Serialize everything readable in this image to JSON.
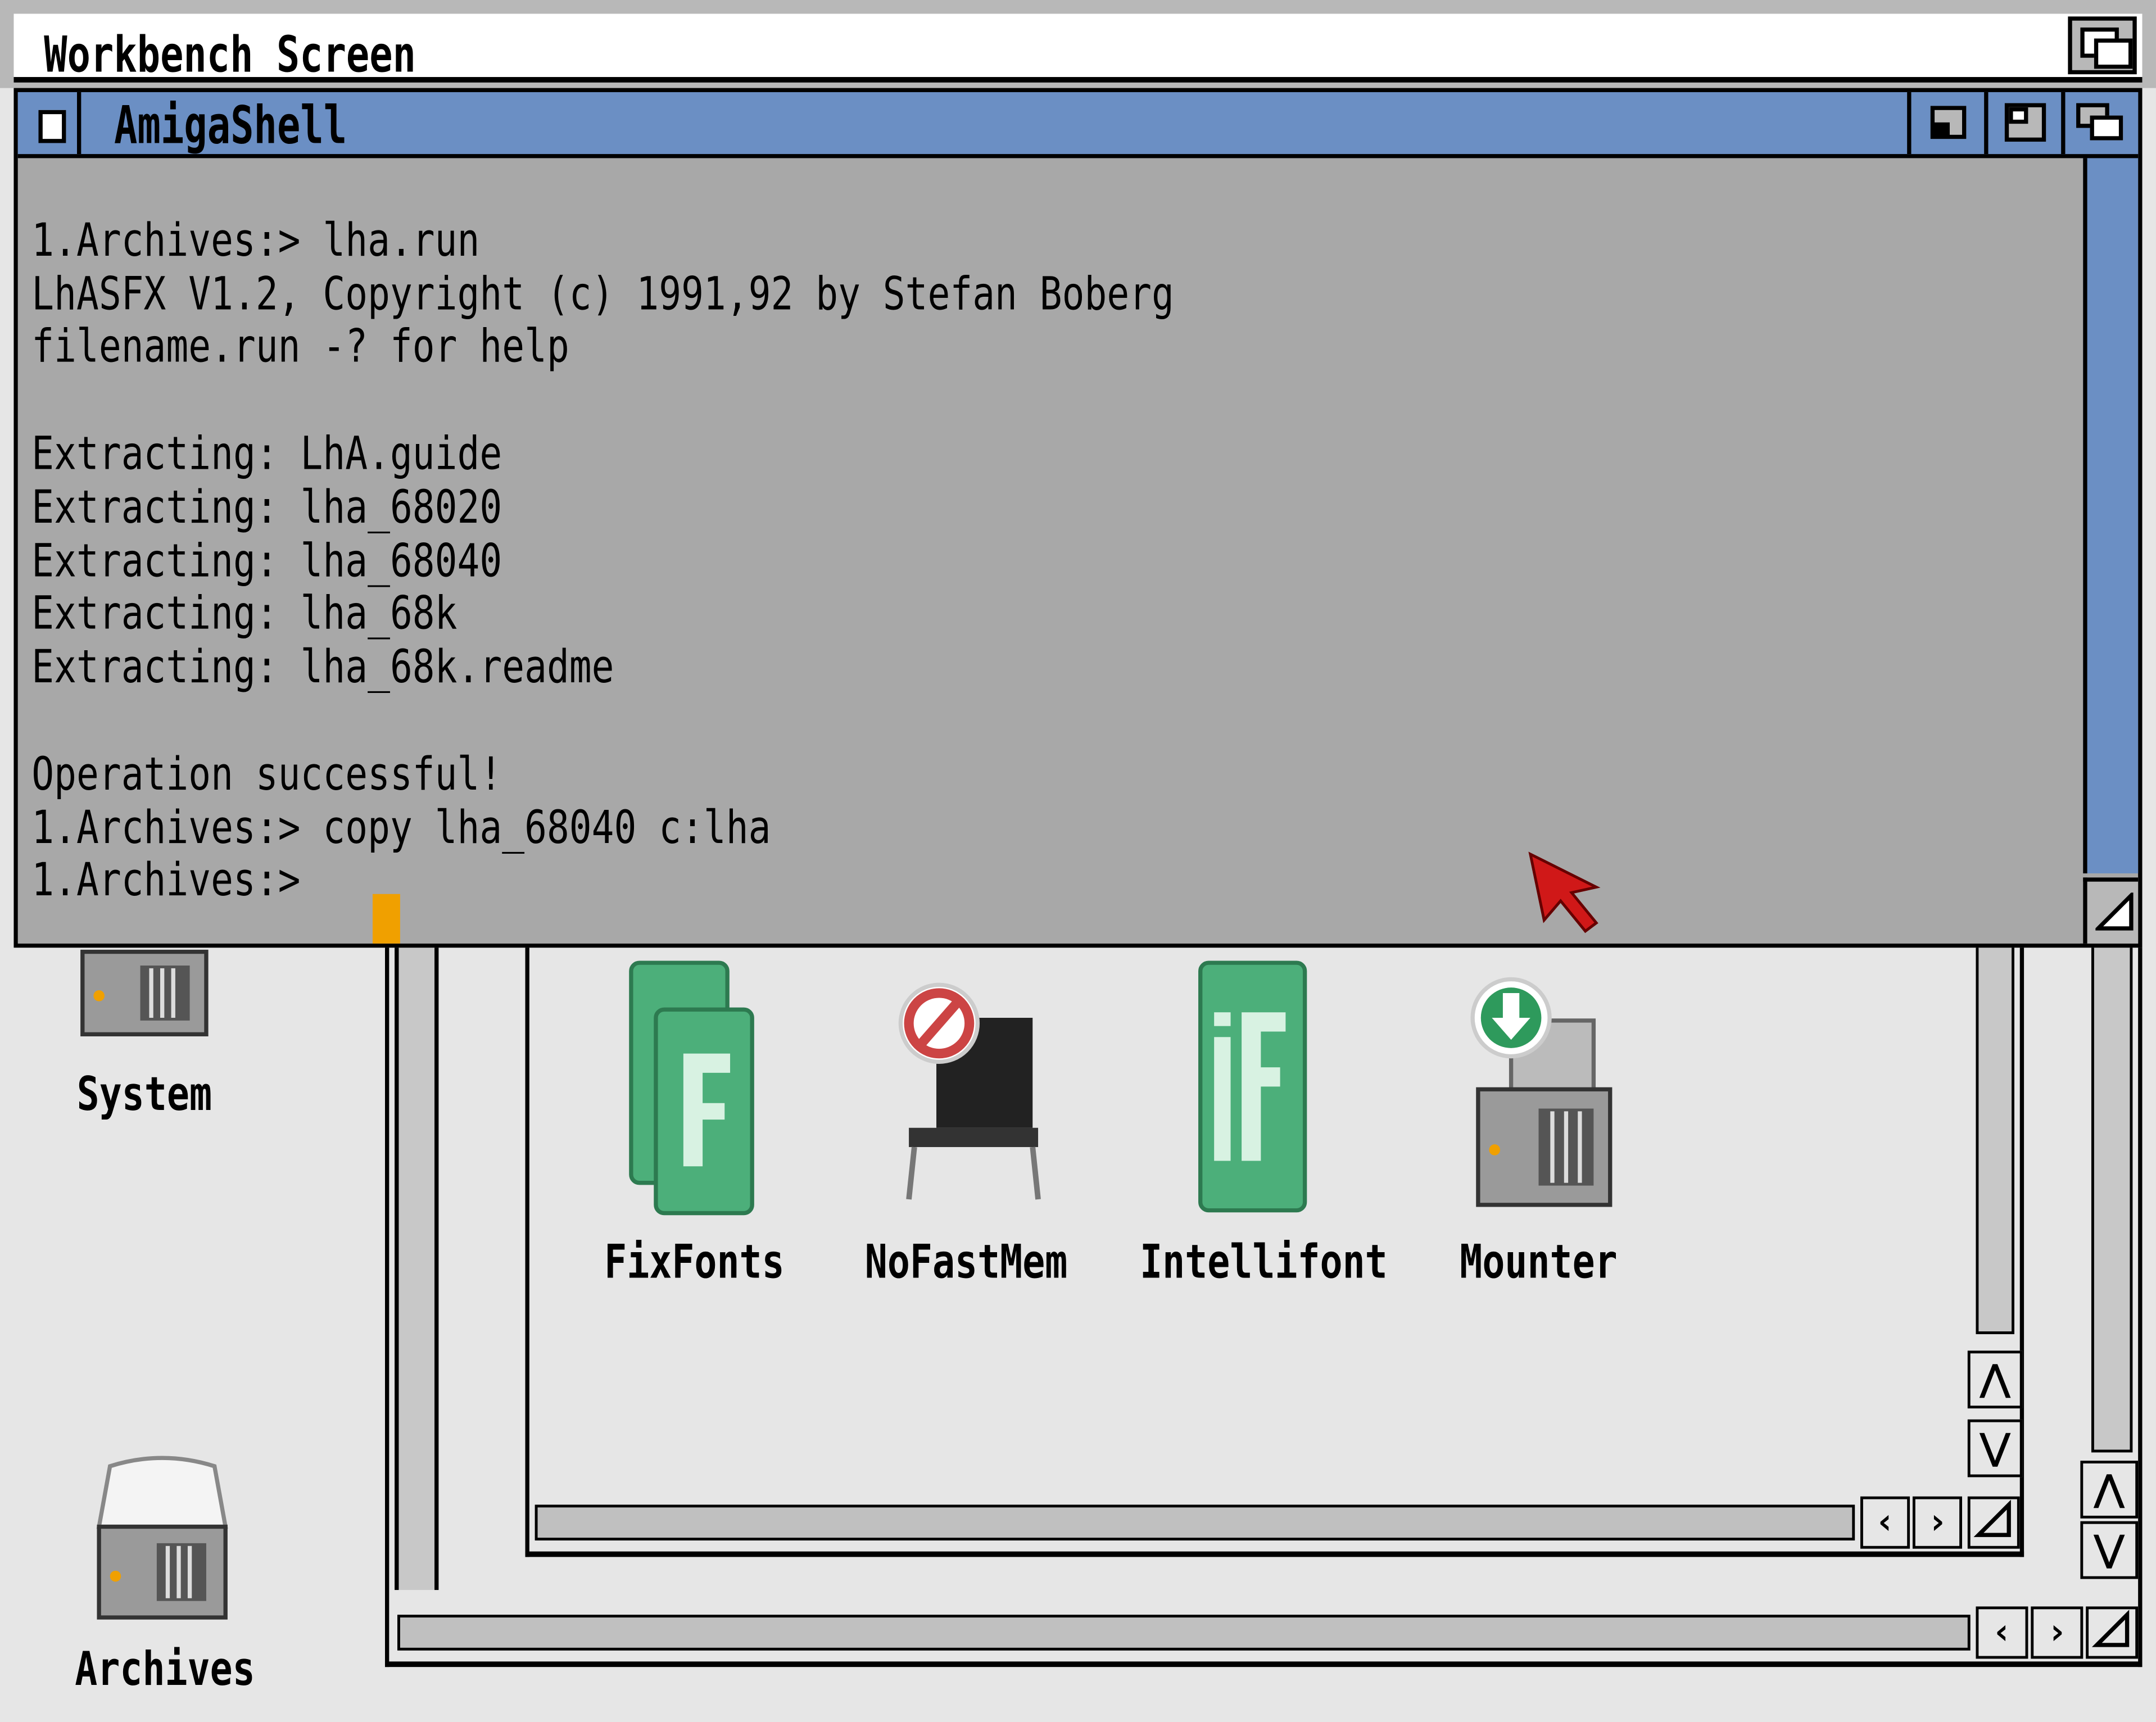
{
  "screen": {
    "title": "Workbench Screen"
  },
  "shell": {
    "title": "AmigaShell",
    "lines": [
      "1.Archives:> lha.run",
      "LhASFX V1.2, Copyright (c) 1991,92 by Stefan Boberg",
      "filename.run -? for help",
      "",
      "Extracting: LhA.guide",
      "Extracting: lha_68020",
      "Extracting: lha_68040",
      "Extracting: lha_68k",
      "Extracting: lha_68k.readme",
      "",
      "Operation successful!",
      "1.Archives:> copy lha_68040 c:lha",
      "1.Archives:> "
    ]
  },
  "desktop": {
    "icons": [
      {
        "label": "System",
        "icon": "harddisk-icon"
      },
      {
        "label": "Archives",
        "icon": "harddisk-icon"
      }
    ]
  },
  "drawer": {
    "icons": [
      {
        "label": "FixFonts",
        "icon": "fixfonts-icon"
      },
      {
        "label": "NoFastMem",
        "icon": "nofastmem-icon"
      },
      {
        "label": "Intellifont",
        "icon": "intellifont-icon"
      },
      {
        "label": "Mounter",
        "icon": "mounter-icon"
      }
    ]
  },
  "arrows": {
    "up": "⋀",
    "down": "⋁",
    "left": "‹",
    "right": "›"
  },
  "colors": {
    "titlebar": "#6b8fc4",
    "console_bg": "#a8a8a8",
    "cursor": "#f0a000",
    "icon_green": "#4caf7a"
  }
}
